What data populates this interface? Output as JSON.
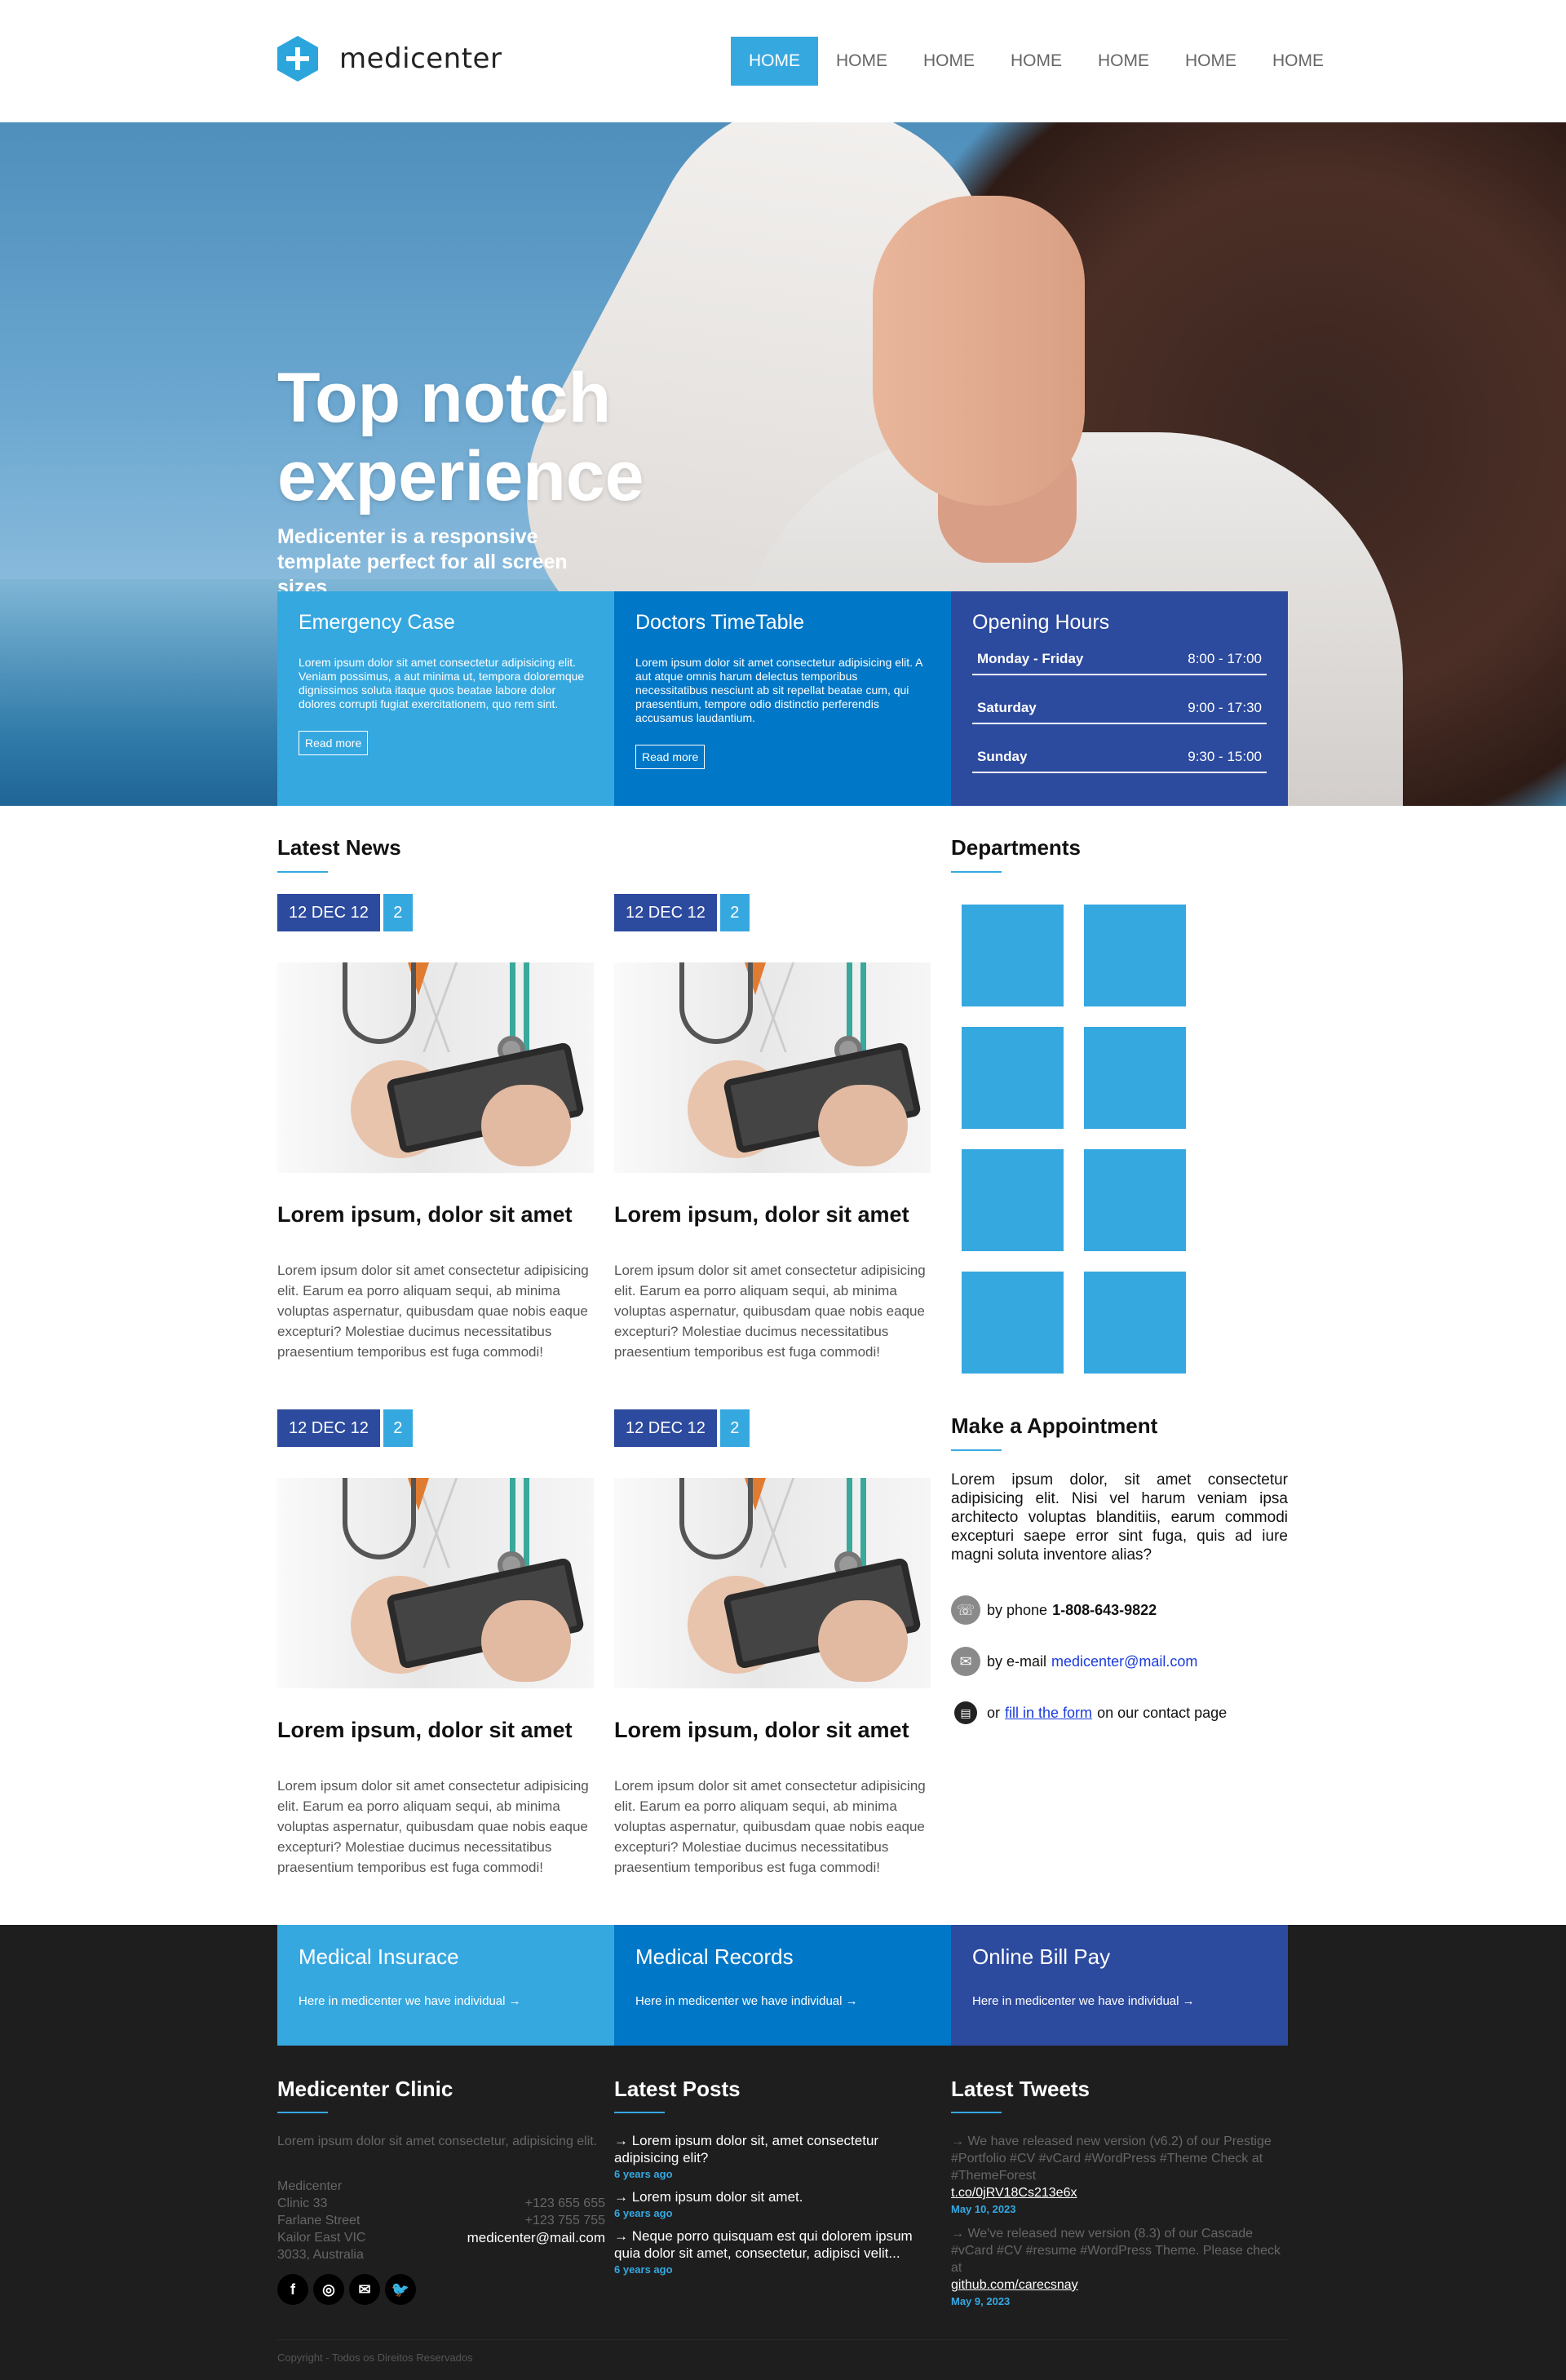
{
  "header": {
    "brand": "medicenter",
    "nav": [
      "HOME",
      "HOME",
      "HOME",
      "HOME",
      "HOME",
      "HOME",
      "HOME"
    ],
    "active_index": 0
  },
  "hero": {
    "title": "Top notch experience",
    "subtitle": "Medicenter is a responsive template perfect for all screen sizes"
  },
  "info_boxes": [
    {
      "title": "Emergency Case",
      "text": "Lorem ipsum dolor sit amet consectetur adipisicing elit. Veniam possimus, a aut minima ut, tempora doloremque dignissimos soluta itaque quos beatae labore dolor dolores corrupti fugiat exercitationem, quo rem sint.",
      "button": "Read more",
      "color": "#36a8e0"
    },
    {
      "title": "Doctors TimeTable",
      "text": "Lorem ipsum dolor sit amet consectetur adipisicing elit. A aut atque omnis harum delectus temporibus necessitatibus nesciunt ab sit repellat beatae cum, qui praesentium, tempore odio distinctio perferendis accusamus laudantium.",
      "button": "Read more",
      "color": "#0077c7"
    },
    {
      "title": "Opening Hours",
      "color": "#2c4a9e",
      "hours": [
        {
          "day": "Monday - Friday",
          "time": "8:00 - 17:00"
        },
        {
          "day": "Saturday",
          "time": "9:00 - 17:30"
        },
        {
          "day": "Sunday",
          "time": "9:30 - 15:00"
        }
      ]
    }
  ],
  "news": {
    "heading": "Latest News",
    "items": [
      {
        "date": "12 DEC 12",
        "comments": "2",
        "title": "Lorem ipsum, dolor sit amet",
        "text": "Lorem ipsum dolor sit amet consectetur adipisicing elit. Earum ea porro aliquam sequi, ab minima voluptas aspernatur, quibusdam quae nobis eaque excepturi? Molestiae ducimus necessitatibus praesentium temporibus est fuga commodi!"
      },
      {
        "date": "12 DEC 12",
        "comments": "2",
        "title": "Lorem ipsum, dolor sit amet",
        "text": "Lorem ipsum dolor sit amet consectetur adipisicing elit. Earum ea porro aliquam sequi, ab minima voluptas aspernatur, quibusdam quae nobis eaque excepturi? Molestiae ducimus necessitatibus praesentium temporibus est fuga commodi!"
      },
      {
        "date": "12 DEC 12",
        "comments": "2",
        "title": "Lorem ipsum, dolor sit amet",
        "text": "Lorem ipsum dolor sit amet consectetur adipisicing elit. Earum ea porro aliquam sequi, ab minima voluptas aspernatur, quibusdam quae nobis eaque excepturi? Molestiae ducimus necessitatibus praesentium temporibus est fuga commodi!"
      },
      {
        "date": "12 DEC 12",
        "comments": "2",
        "title": "Lorem ipsum, dolor sit amet",
        "text": "Lorem ipsum dolor sit amet consectetur adipisicing elit. Earum ea porro aliquam sequi, ab minima voluptas aspernatur, quibusdam quae nobis eaque excepturi? Molestiae ducimus necessitatibus praesentium temporibus est fuga commodi!"
      }
    ]
  },
  "departments": {
    "heading": "Departments",
    "tile_color": "#36a8e0",
    "tile_count": 8
  },
  "appointment": {
    "heading": "Make a Appointment",
    "text": "Lorem ipsum dolor, sit amet consectetur adipisicing elit. Nisi vel harum veniam ipsa architecto voluptas blanditiis, earum commodi excepturi saepe error sint fuga, quis ad iure magni soluta inventore alias?",
    "phone_label": "by phone",
    "phone": "1-808-643-9822",
    "email_label": "by e-mail",
    "email": "medicenter@mail.com",
    "form_prefix": "or",
    "form_link": "fill in the form",
    "form_suffix": "on our contact page"
  },
  "footer_boxes": [
    {
      "title": "Medical Insurace",
      "text": "Here in medicenter we have individual →",
      "color": "#36a8e0"
    },
    {
      "title": "Medical Records",
      "text": "Here in medicenter we have individual →",
      "color": "#0077c7"
    },
    {
      "title": "Online Bill Pay",
      "text": "Here in medicenter we have individual →",
      "color": "#2c4a9e"
    }
  ],
  "clinic": {
    "heading": "Medicenter Clinic",
    "intro": "Lorem ipsum dolor sit amet consectetur, adipisicing elit.",
    "address": [
      "Medicenter",
      "Clinic 33",
      "Farlane Street",
      "Kailor East VIC",
      "3033, Australia"
    ],
    "phones": [
      "+123 655 655",
      "+123 755 755"
    ],
    "email": "medicenter@mail.com"
  },
  "latest_posts": {
    "heading": "Latest Posts",
    "items": [
      {
        "title": "→ Lorem ipsum dolor sit, amet consectetur adipisicing elit?",
        "ago": "6 years ago"
      },
      {
        "title": "→ Lorem ipsum dolor sit amet.",
        "ago": "6 years ago"
      },
      {
        "title": "→ Neque porro quisquam est qui dolorem ipsum quia dolor sit amet, consectetur, adipisci velit...",
        "ago": "6 years ago"
      }
    ]
  },
  "latest_tweets": {
    "heading": "Latest Tweets",
    "items": [
      {
        "text": "→ We have released new version (v6.2) of our Prestige #Portfolio #CV #vCard #WordPress #Theme Check at #ThemeForest",
        "link": "t.co/0jRV18Cs213e6x",
        "date": "May 10, 2023"
      },
      {
        "text": "→ We've released new version (8.3) of our Cascade #vCard #CV #resume #WordPress Theme. Please check at",
        "link": "github.com/carecsnay",
        "date": "May 9, 2023"
      }
    ]
  },
  "social": [
    {
      "icon": "facebook-icon",
      "glyph": "f"
    },
    {
      "icon": "instagram-icon",
      "glyph": "◎"
    },
    {
      "icon": "email-icon",
      "glyph": "✉"
    },
    {
      "icon": "twitter-icon",
      "glyph": "🐦"
    }
  ],
  "copyright": "Copyright - Todos os Direitos Reservados"
}
